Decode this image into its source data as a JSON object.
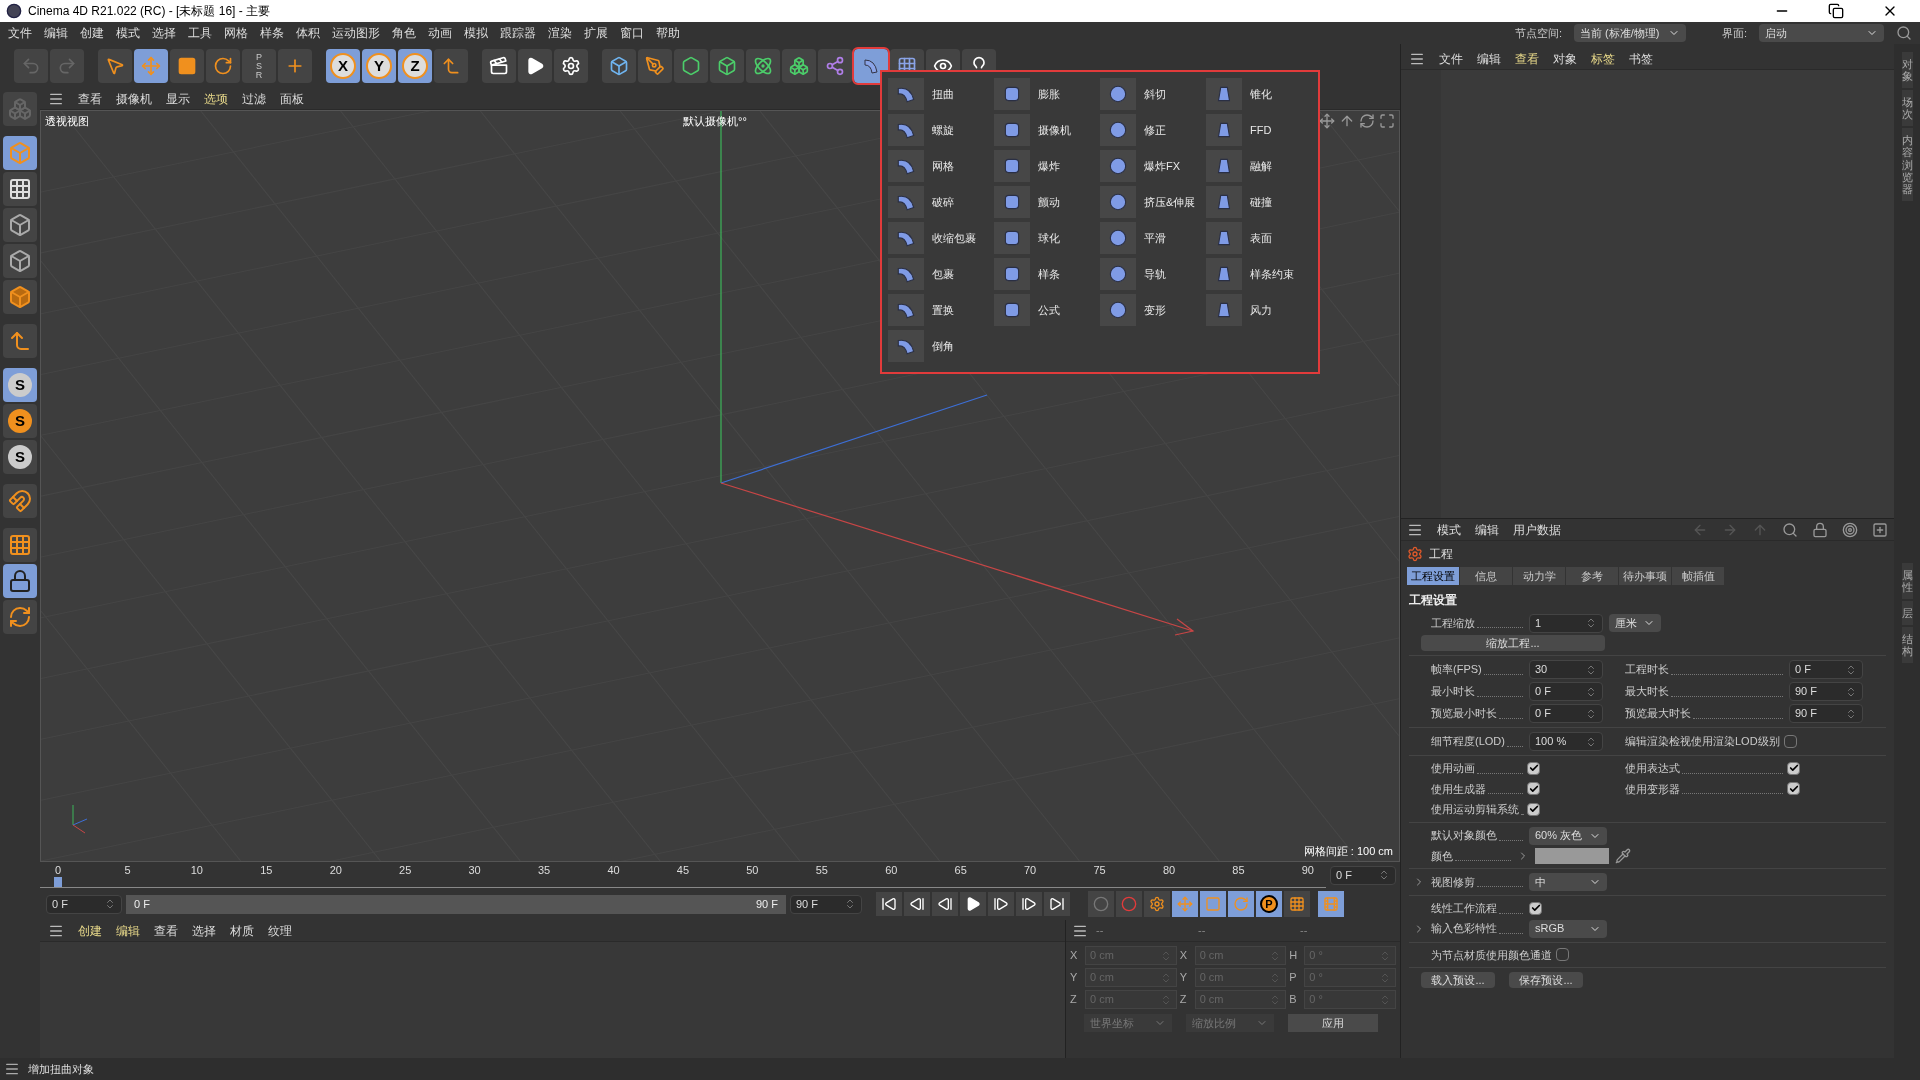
{
  "window": {
    "title": "Cinema 4D R21.022 (RC) - [未标题 16] - 主要"
  },
  "menu_bar": [
    "文件",
    "编辑",
    "创建",
    "模式",
    "选择",
    "工具",
    "网格",
    "样条",
    "体积",
    "运动图形",
    "角色",
    "动画",
    "模拟",
    "跟踪器",
    "渲染",
    "扩展",
    "窗口",
    "帮助"
  ],
  "node_space": {
    "label": "节点空间:",
    "value": "当前 (标准/物理)"
  },
  "layout": {
    "label": "界面:",
    "value": "启动"
  },
  "toolbar": [
    {
      "selected": false
    },
    {
      "selected": false
    },
    {
      "selected": false
    },
    {
      "selected": true
    },
    {
      "selected": false
    },
    {
      "selected": false
    },
    {
      "selected": false,
      "label": "PSR"
    },
    {
      "selected": false
    },
    {
      "selected": true,
      "label": "X"
    },
    {
      "selected": true,
      "label": "Y"
    },
    {
      "selected": true,
      "label": "Z"
    },
    {
      "selected": false
    },
    {
      "selected": false
    },
    {
      "selected": false
    },
    {
      "selected": false
    },
    {
      "selected": false
    },
    {
      "selected": false
    },
    {
      "selected": false
    },
    {
      "selected": false
    },
    {
      "selected": false
    },
    {
      "selected": false
    },
    {
      "selected": false
    },
    {
      "selected": true
    },
    {
      "selected": false
    },
    {
      "selected": false
    },
    {
      "selected": false
    }
  ],
  "left_tools": [
    {
      "selected": false
    },
    {
      "selected": true
    },
    {
      "selected": false
    },
    {
      "selected": false
    },
    {
      "selected": false
    },
    {
      "selected": false
    },
    {
      "selected": false
    },
    {
      "selected": true,
      "label": "S"
    },
    {
      "selected": false,
      "label": "S"
    },
    {
      "selected": false,
      "label": "S"
    },
    {
      "selected": false
    },
    {
      "selected": false
    },
    {
      "selected": true
    },
    {
      "selected": false
    }
  ],
  "viewport": {
    "menu": [
      {
        "label": "查看",
        "highlighted": false
      },
      {
        "label": "摄像机",
        "highlighted": false
      },
      {
        "label": "显示",
        "highlighted": false
      },
      {
        "label": "选项",
        "highlighted": true
      },
      {
        "label": "过滤",
        "highlighted": false
      },
      {
        "label": "面板",
        "highlighted": false
      }
    ],
    "name": "透视视图",
    "camera": "默认摄像机°°",
    "grid_spacing": "网格间距 : 100 cm"
  },
  "deformer_menu": {
    "items": [
      "扭曲",
      "膨胀",
      "斜切",
      "锥化",
      "螺旋",
      "摄像机",
      "修正",
      "FFD",
      "网格",
      "爆炸",
      "爆炸FX",
      "融解",
      "破碎",
      "颤动",
      "挤压&伸展",
      "碰撞",
      "收缩包裹",
      "球化",
      "平滑",
      "表面",
      "包裹",
      "样条",
      "导轨",
      "样条约束",
      "置换",
      "公式",
      "变形",
      "风力",
      "倒角"
    ]
  },
  "object_manager": {
    "menu": [
      {
        "label": "文件",
        "highlighted": false
      },
      {
        "label": "编辑",
        "highlighted": false
      },
      {
        "label": "查看",
        "highlighted": true
      },
      {
        "label": "对象",
        "highlighted": false
      },
      {
        "label": "标签",
        "highlighted": true
      },
      {
        "label": "书签",
        "highlighted": false
      }
    ]
  },
  "attributes": {
    "menu": [
      "模式",
      "编辑",
      "用户数据"
    ],
    "title": "工程",
    "tabs": [
      {
        "label": "工程设置",
        "selected": true
      },
      {
        "label": "信息",
        "selected": false
      },
      {
        "label": "动力学",
        "selected": false
      },
      {
        "label": "参考",
        "selected": false
      },
      {
        "label": "待办事项",
        "selected": false
      },
      {
        "label": "帧插值",
        "selected": false
      }
    ],
    "section": "工程设置",
    "scale": {
      "label": "工程缩放",
      "value": "1",
      "unit": "厘米"
    },
    "scale_button": "缩放工程...",
    "time_left": [
      {
        "label": "帧率(FPS)",
        "value": "30"
      },
      {
        "label": "最小时长",
        "value": "0 F"
      },
      {
        "label": "预览最小时长",
        "value": "0 F"
      }
    ],
    "time_right": [
      {
        "label": "工程时长",
        "value": "0 F"
      },
      {
        "label": "最大时长",
        "value": "90 F"
      },
      {
        "label": "预览最大时长",
        "value": "90 F"
      }
    ],
    "lod": {
      "label": "细节程度(LOD)",
      "value": "100 %"
    },
    "lod_render": {
      "label": "编辑渲染检视使用渲染LOD级别",
      "checked": false
    },
    "checks_left": [
      {
        "label": "使用动画",
        "checked": true
      },
      {
        "label": "使用生成器",
        "checked": true
      },
      {
        "label": "使用运动剪辑系统",
        "checked": true
      }
    ],
    "checks_right": [
      {
        "label": "使用表达式",
        "checked": true
      },
      {
        "label": "使用变形器",
        "checked": true
      }
    ],
    "default_color": {
      "label": "默认对象颜色",
      "value": "60% 灰色"
    },
    "color": {
      "label": "颜色",
      "color": "#999999"
    },
    "clipping": {
      "label": "视图修剪",
      "value": "中"
    },
    "linear": {
      "label": "线性工作流程",
      "checked": true
    },
    "input_color": {
      "label": "输入色彩特性",
      "value": "sRGB"
    },
    "node_color": {
      "label": "为节点材质使用颜色通道",
      "checked": false
    },
    "buttons": [
      "载入预设...",
      "保存预设..."
    ]
  },
  "side_tabs_top": [
    "对象",
    "场次",
    "内容浏览器"
  ],
  "side_tabs_bottom": [
    "属性",
    "层",
    "结构"
  ],
  "timeline": {
    "ticks": [
      "0",
      "5",
      "10",
      "15",
      "20",
      "25",
      "30",
      "35",
      "40",
      "45",
      "50",
      "55",
      "60",
      "65",
      "70",
      "75",
      "80",
      "85",
      "90"
    ],
    "current": "0 F",
    "start": "0 F",
    "range_bar": {
      "level": 1
    },
    "range_start": "0 F",
    "range_end": "90 F",
    "end": "90 F",
    "key_tools": [
      {
        "selected": false
      },
      {
        "selected": false
      },
      {
        "selected": false
      },
      {
        "selected": true
      },
      {
        "selected": true
      },
      {
        "selected": true
      },
      {
        "selected": true,
        "label": "P"
      },
      {
        "selected": false
      }
    ]
  },
  "material_manager": {
    "menu": [
      {
        "label": "创建",
        "highlighted": true
      },
      {
        "label": "编辑",
        "highlighted": true
      },
      {
        "label": "查看",
        "highlighted": false
      },
      {
        "label": "选择",
        "highlighted": false
      },
      {
        "label": "材质",
        "highlighted": false
      },
      {
        "label": "纹理",
        "highlighted": false
      }
    ]
  },
  "coordinates": {
    "headers": [
      "--",
      "--",
      "--"
    ],
    "rows": [
      {
        "axis": "X",
        "position": "0 cm",
        "axis2": "X",
        "size": "0 cm",
        "axis3": "H",
        "rotation": "0 °"
      },
      {
        "axis": "Y",
        "position": "0 cm",
        "axis2": "Y",
        "size": "0 cm",
        "axis3": "P",
        "rotation": "0 °"
      },
      {
        "axis": "Z",
        "position": "0 cm",
        "axis2": "Z",
        "size": "0 cm",
        "axis3": "B",
        "rotation": "0 °"
      }
    ],
    "mode": "世界坐标",
    "scale_mode": "缩放比例",
    "apply": "应用"
  },
  "status_bar": {
    "text": "增加扭曲对象"
  }
}
